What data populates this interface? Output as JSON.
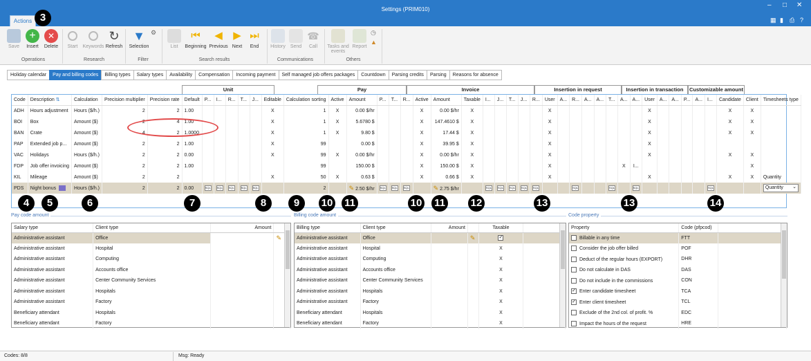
{
  "window": {
    "title": "Settings (PRIM010)",
    "ribbon_tab": "Actions"
  },
  "ribbon": {
    "operations": {
      "label": "Operations",
      "save": "Save",
      "insert": "Insert",
      "delete": "Delete"
    },
    "research": {
      "label": "Research",
      "start": "Start",
      "keywords": "Keywords",
      "refresh": "Refresh"
    },
    "filter": {
      "label": "Filter",
      "selection": "Selection"
    },
    "search_results": {
      "label": "Search results",
      "list": "List",
      "beginning": "Beginning",
      "previous": "Previous",
      "next": "Next",
      "end": "End"
    },
    "communications": {
      "label": "Communications",
      "history": "History",
      "send": "Send",
      "call": "Call"
    },
    "others": {
      "label": "Others",
      "tasks": "Tasks and",
      "tasks2": "events",
      "report": "Report"
    }
  },
  "tabs": [
    "Holiday calendar",
    "Pay and billing codes",
    "Billing types",
    "Salary types",
    "Availability",
    "Compensation",
    "Incoming payment",
    "Self managed job offers packages",
    "Countdown",
    "Parsing credits",
    "Parsing",
    "Reasons for absence"
  ],
  "group_headers": {
    "unit": "Unit",
    "pay": "Pay",
    "invoice": "Invoice",
    "ins_request": "Insertion in request",
    "ins_transaction": "Insertion in transaction",
    "custom_amount": "Customizable amount"
  },
  "columns": {
    "code": "Code",
    "description": "Description",
    "calculation": "Calculation",
    "precision_multiplier": "Precision multiplier",
    "precision_rate": "Precision rate",
    "default": "Default",
    "p": "P...",
    "i": "I...",
    "r": "R...",
    "t": "T...",
    "j": "J...",
    "editable": "Editable",
    "calc_sorting": "Calculation sorting",
    "active": "Active",
    "amount": "Amount",
    "taxable": "Taxable",
    "user": "User",
    "a": "A...",
    "candidate": "Candidate",
    "client": "Client",
    "timesheets_type": "Timesheets type"
  },
  "rows": [
    {
      "code": "ADH",
      "desc": "Hours adjustment",
      "calc": "Hours ($/h.)",
      "pm": "2",
      "pr": "2",
      "def": "1.00",
      "edit": "X",
      "sort": "1",
      "pact": "X",
      "pamt": "0.00 $/hr",
      "iact": "X",
      "iamt": "0.00 $/hr",
      "tax": "X",
      "user": "X",
      "tuser": "X",
      "cand": "X",
      "cli": "X",
      "ts": ""
    },
    {
      "code": "BOI",
      "desc": "Box",
      "calc": "Amount ($)",
      "pm": "2",
      "pr": "4",
      "def": "1.00",
      "edit": "X",
      "sort": "1",
      "pact": "X",
      "pamt": "5.6780 $",
      "iact": "X",
      "iamt": "147.4610 $",
      "tax": "X",
      "user": "X",
      "tuser": "X",
      "cand": "X",
      "cli": "X",
      "ts": ""
    },
    {
      "code": "BAN",
      "desc": "Crate",
      "calc": "Amount ($)",
      "pm": "4",
      "pr": "2",
      "def": "1.0000",
      "edit": "X",
      "sort": "1",
      "pact": "X",
      "pamt": "9.80 $",
      "iact": "X",
      "iamt": "17.44 $",
      "tax": "X",
      "user": "X",
      "tuser": "X",
      "cand": "X",
      "cli": "X",
      "ts": ""
    },
    {
      "code": "PAP",
      "desc": "Extended job p...",
      "calc": "Amount ($)",
      "pm": "2",
      "pr": "2",
      "def": "1.00",
      "edit": "X",
      "sort": "99",
      "pact": "",
      "pamt": "0.00 $",
      "iact": "X",
      "iamt": "39.95 $",
      "tax": "X",
      "user": "X",
      "tuser": "X",
      "cand": "",
      "cli": "",
      "ts": ""
    },
    {
      "code": "VAC",
      "desc": "Holidays",
      "calc": "Hours ($/h.)",
      "pm": "2",
      "pr": "2",
      "def": "0.00",
      "edit": "X",
      "sort": "99",
      "pact": "X",
      "pamt": "0.00 $/hr",
      "iact": "X",
      "iamt": "0.00 $/hr",
      "tax": "X",
      "user": "X",
      "tuser": "X",
      "cand": "X",
      "cli": "X",
      "ts": ""
    },
    {
      "code": "FDP",
      "desc": "Job offer invoicing",
      "calc": "Amount ($)",
      "pm": "2",
      "pr": "2",
      "def": "1.00",
      "edit": "",
      "sort": "99",
      "pact": "",
      "pamt": "150.00 $",
      "iact": "X",
      "iamt": "150.00 $",
      "tax": "X",
      "user": "X",
      "tuser": "I...",
      "cand": "",
      "cli": "X",
      "ts": ""
    },
    {
      "code": "KIL",
      "desc": "Mileage",
      "calc": "Amount ($)",
      "pm": "2",
      "pr": "2",
      "def": "",
      "edit": "X",
      "sort": "50",
      "pact": "X",
      "pamt": "0.63 $",
      "iact": "X",
      "iamt": "0.66 $",
      "tax": "X",
      "user": "X",
      "tuser": "X",
      "cand": "X",
      "cli": "X",
      "ts": "Quantity"
    },
    {
      "code": "PDS",
      "desc": "Night bonus",
      "calc": "Hours ($/h.)",
      "pm": "2",
      "pr": "2",
      "def": "0.00",
      "edit": "",
      "sort": "2",
      "pact": "",
      "pamt": "2.50 $/hr",
      "iact": "",
      "iamt": "2.75 $/hr",
      "tax": "",
      "user": "",
      "tuser": "",
      "cand": "",
      "cli": "",
      "ts": "Quantity"
    }
  ],
  "sql_label": "SQL",
  "badges": [
    "3",
    "4",
    "5",
    "6",
    "7",
    "8",
    "9",
    "10",
    "11",
    "10",
    "11",
    "12",
    "13",
    "13",
    "14"
  ],
  "pay_code_amount": {
    "title": "Pay code amount",
    "headers": [
      "Salary type",
      "Client type",
      "Amount"
    ],
    "rows": [
      [
        "Administrative assistant",
        "Office"
      ],
      [
        "Administrative assistant",
        "Hospital"
      ],
      [
        "Administrative assistant",
        "Computing"
      ],
      [
        "Administrative assistant",
        "Accounts office"
      ],
      [
        "Administrative assistant",
        "Center Community Services"
      ],
      [
        "Administrative assistant",
        "Hospitals"
      ],
      [
        "Administrative assistant",
        "Factory"
      ],
      [
        "Beneficiary attendant",
        "Hospitals"
      ],
      [
        "Beneficiary attendant",
        "Factory"
      ]
    ]
  },
  "billing_code_amount": {
    "title": "Billing code amount",
    "headers": [
      "Billing type",
      "Client type",
      "Amount",
      "Taxable"
    ],
    "rows": [
      [
        "Administrative assistant",
        "Office",
        ""
      ],
      [
        "Administrative assistant",
        "Hospital",
        "X"
      ],
      [
        "Administrative assistant",
        "Computing",
        "X"
      ],
      [
        "Administrative assistant",
        "Accounts office",
        "X"
      ],
      [
        "Administrative assistant",
        "Center Community Services",
        "X"
      ],
      [
        "Administrative assistant",
        "Hospitals",
        "X"
      ],
      [
        "Administrative assistant",
        "Factory",
        "X"
      ],
      [
        "Beneficiary attendant",
        "Hospitals",
        "X"
      ],
      [
        "Beneficiary attendant",
        "Factory",
        "X"
      ]
    ]
  },
  "code_property": {
    "title": "Code property",
    "headers": [
      "Property",
      "Code (pfpcod)"
    ],
    "rows": [
      {
        "label": "Billable in any time",
        "code": "FTT",
        "checked": false
      },
      {
        "label": "Consider the job offer billed",
        "code": "POF",
        "checked": false
      },
      {
        "label": "Deduct of the regular hours (EXPORT)",
        "code": "DHR",
        "checked": false
      },
      {
        "label": "Do not calculate in DAS",
        "code": "DAS",
        "checked": false
      },
      {
        "label": "Do not include in the commissions",
        "code": "CON",
        "checked": false
      },
      {
        "label": "Enter candidate timesheet",
        "code": "TCA",
        "checked": true
      },
      {
        "label": "Enter client timesheet",
        "code": "TCL",
        "checked": true
      },
      {
        "label": "Exclude of the 2nd col. of profit. %",
        "code": "EDC",
        "checked": false
      },
      {
        "label": "Impact the hours of the request",
        "code": "HRE",
        "checked": false
      }
    ]
  },
  "status": {
    "codes": "Codes: 8/8",
    "msg": "Msg: Ready"
  },
  "colors": {
    "accent": "#2b7ac9",
    "highlight": "#e24a4a",
    "selected_row": "#ddd6c6"
  }
}
